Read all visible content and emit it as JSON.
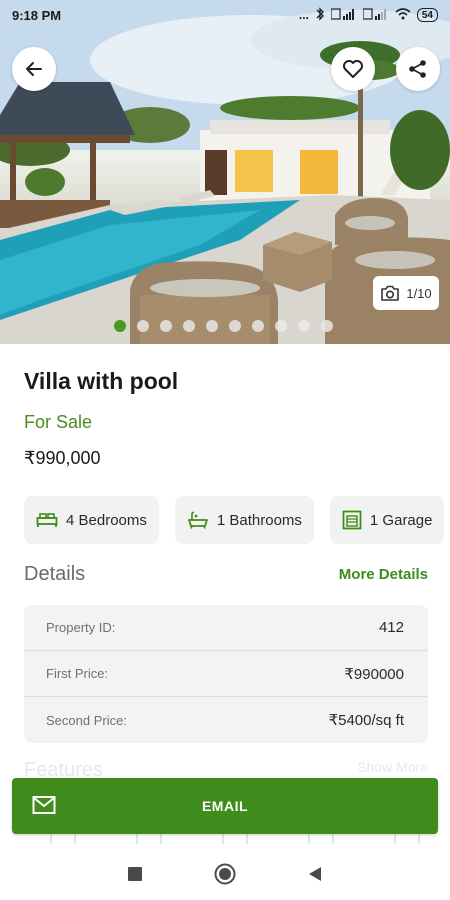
{
  "status_bar": {
    "time": "9:18 PM",
    "indicators": "...",
    "battery": "54"
  },
  "hero": {
    "photo_counter": "1/10",
    "slide_count": 10,
    "active_slide": 1
  },
  "property": {
    "title": "Villa with pool",
    "status": "For Sale",
    "price": "₹990,000"
  },
  "amenities": [
    {
      "icon": "bed-icon",
      "label": "4  Bedrooms"
    },
    {
      "icon": "bathtub-icon",
      "label": "1 Bathrooms"
    },
    {
      "icon": "garage-icon",
      "label": "1 Garage"
    }
  ],
  "details": {
    "title": "Details",
    "more_link": "More Details",
    "rows": [
      {
        "label": "Property ID:",
        "value": "412"
      },
      {
        "label": "First Price:",
        "value": "₹990000"
      },
      {
        "label": "Second Price:",
        "value": "₹5400/sq ft"
      }
    ]
  },
  "features": {
    "title": "Features",
    "more_link": "Show More"
  },
  "actions": {
    "email_label": "EMAIL"
  },
  "colors": {
    "accent": "#3f8c1c",
    "active_dot": "#4a9a1e",
    "chip_bg": "#f2f2f2",
    "card_bg": "#f3f3f3"
  }
}
